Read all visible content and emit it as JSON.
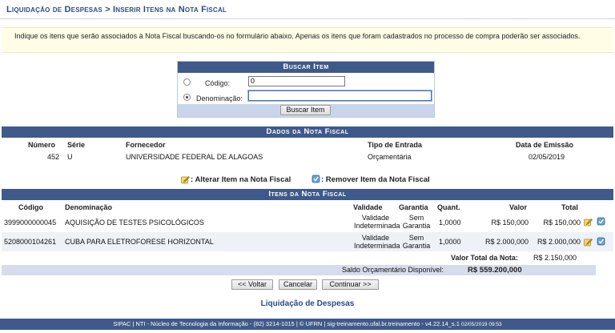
{
  "page": {
    "title": "Liquidação de Despesas > Inserir Itens na Nota Fiscal",
    "info": "Indique os itens que serão associados à Nota Fiscal buscando-os no formulário abaixo. Apenas os itens que foram cadastrados no processo de compra poderão ser associados."
  },
  "search": {
    "title": "Buscar Item",
    "codigo_label": "Código:",
    "codigo_value": "0",
    "denominacao_label": "Denominação:",
    "denominacao_value": "",
    "selected": "denominacao",
    "button": "Buscar Item"
  },
  "nota": {
    "title": "Dados da Nota Fiscal",
    "headers": {
      "numero": "Número",
      "serie": "Série",
      "fornecedor": "Fornecedor",
      "tipo": "Tipo de Entrada",
      "data": "Data de Emissão"
    },
    "numero": "452",
    "serie": "U",
    "fornecedor": "UNIVERSIDADE FEDERAL DE ALAGOAS",
    "tipo": "Orçamentária",
    "data": "02/05/2019"
  },
  "legend": {
    "alterar": ": Alterar Item na Nota Fiscal",
    "remover": ": Remover Item da Nota Fiscal"
  },
  "itens": {
    "title": "Itens da Nota Fiscal",
    "headers": {
      "codigo": "Código",
      "denominacao": "Denominação",
      "validade": "Validade",
      "garantia": "Garantia",
      "quant": "Quant.",
      "valor": "Valor",
      "total": "Total"
    },
    "rows": [
      {
        "codigo": "3999000000045",
        "denominacao": "AQUISIÇÃO DE TESTES PSICOLÓGICOS",
        "validade1": "Validade",
        "validade2": "Indeterminada",
        "garantia1": "Sem",
        "garantia2": "Garantia",
        "quant": "1,0000",
        "valor": "R$ 150,000",
        "total": "R$ 150,000"
      },
      {
        "codigo": "5208000104261",
        "denominacao": "CUBA PARA ELETROFORESE HORIZONTAL",
        "validade1": "Validade",
        "validade2": "Indeterminada",
        "garantia1": "Sem",
        "garantia2": "Garantia",
        "quant": "1,0000",
        "valor": "R$ 2.000,000",
        "total": "R$ 2.000,000"
      }
    ],
    "total_label": "Valor Total da Nota:",
    "total_value": "R$ 2.150,000",
    "saldo_label": "Saldo Orçamentário Disponível:",
    "saldo_value": "R$ 559.200,000"
  },
  "buttons": {
    "voltar": "<< Voltar",
    "cancelar": "Cancelar",
    "continuar": "Continuar >>"
  },
  "link": "Liquidação de Despesas",
  "footer": {
    "main": "SIPAC | NTI - Núcleo de Tecnologia da Informação - (82) 3214-1015 | © UFRN | sig-treinamento.ufal.br.treinamento - v4.22.14_s.1",
    "timestamp": "02/05/2019 09:53"
  },
  "colors": {
    "header_blue": "#3f5a8a",
    "title_blue": "#2b4a86",
    "info_bg": "#fffde5",
    "row_alt": "#eef1f7"
  }
}
